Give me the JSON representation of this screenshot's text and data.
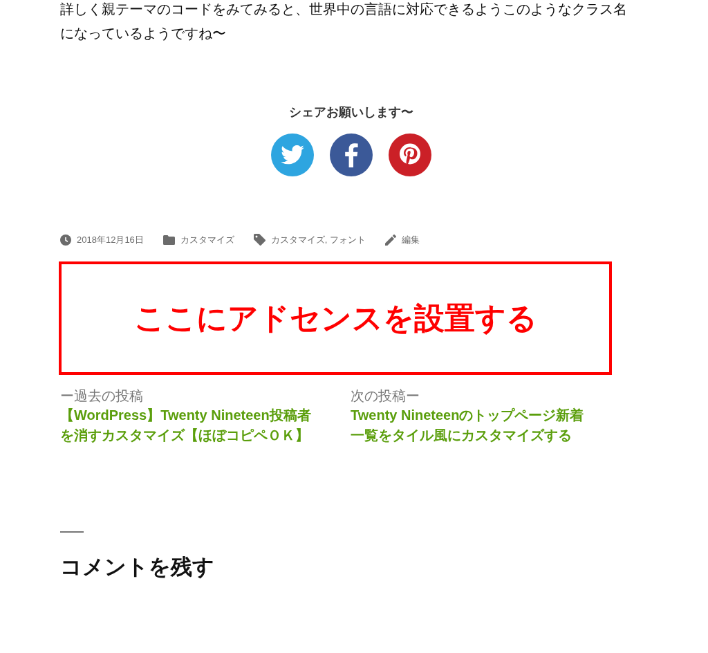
{
  "paragraph": "詳しく親テーマのコードをみてみると、世界中の言語に対応できるようこのようなクラス名になっているようですね〜",
  "share": {
    "heading": "シェアお願いします〜",
    "buttons": [
      {
        "kind": "twitter"
      },
      {
        "kind": "facebook"
      },
      {
        "kind": "pinterest"
      }
    ]
  },
  "meta": [
    {
      "kind": "date",
      "text": "2018年12月16日"
    },
    {
      "kind": "category",
      "text": "カスタマイズ"
    },
    {
      "kind": "tags",
      "text": "カスタマイズ, フォント"
    },
    {
      "kind": "edit",
      "text": "編集"
    }
  ],
  "ad_box": {
    "text": "ここにアドセンスを設置する"
  },
  "post_nav": [
    {
      "label": "ー過去の投稿",
      "title": "【WordPress】Twenty Nineteen投稿者を消すカスタマイズ【ほぼコピペＯＫ】"
    },
    {
      "label": "次の投稿ー",
      "title": "Twenty Nineteenのトップページ新着一覧をタイル風にカスタマイズする"
    }
  ],
  "comments": {
    "heading": "コメントを残す"
  }
}
